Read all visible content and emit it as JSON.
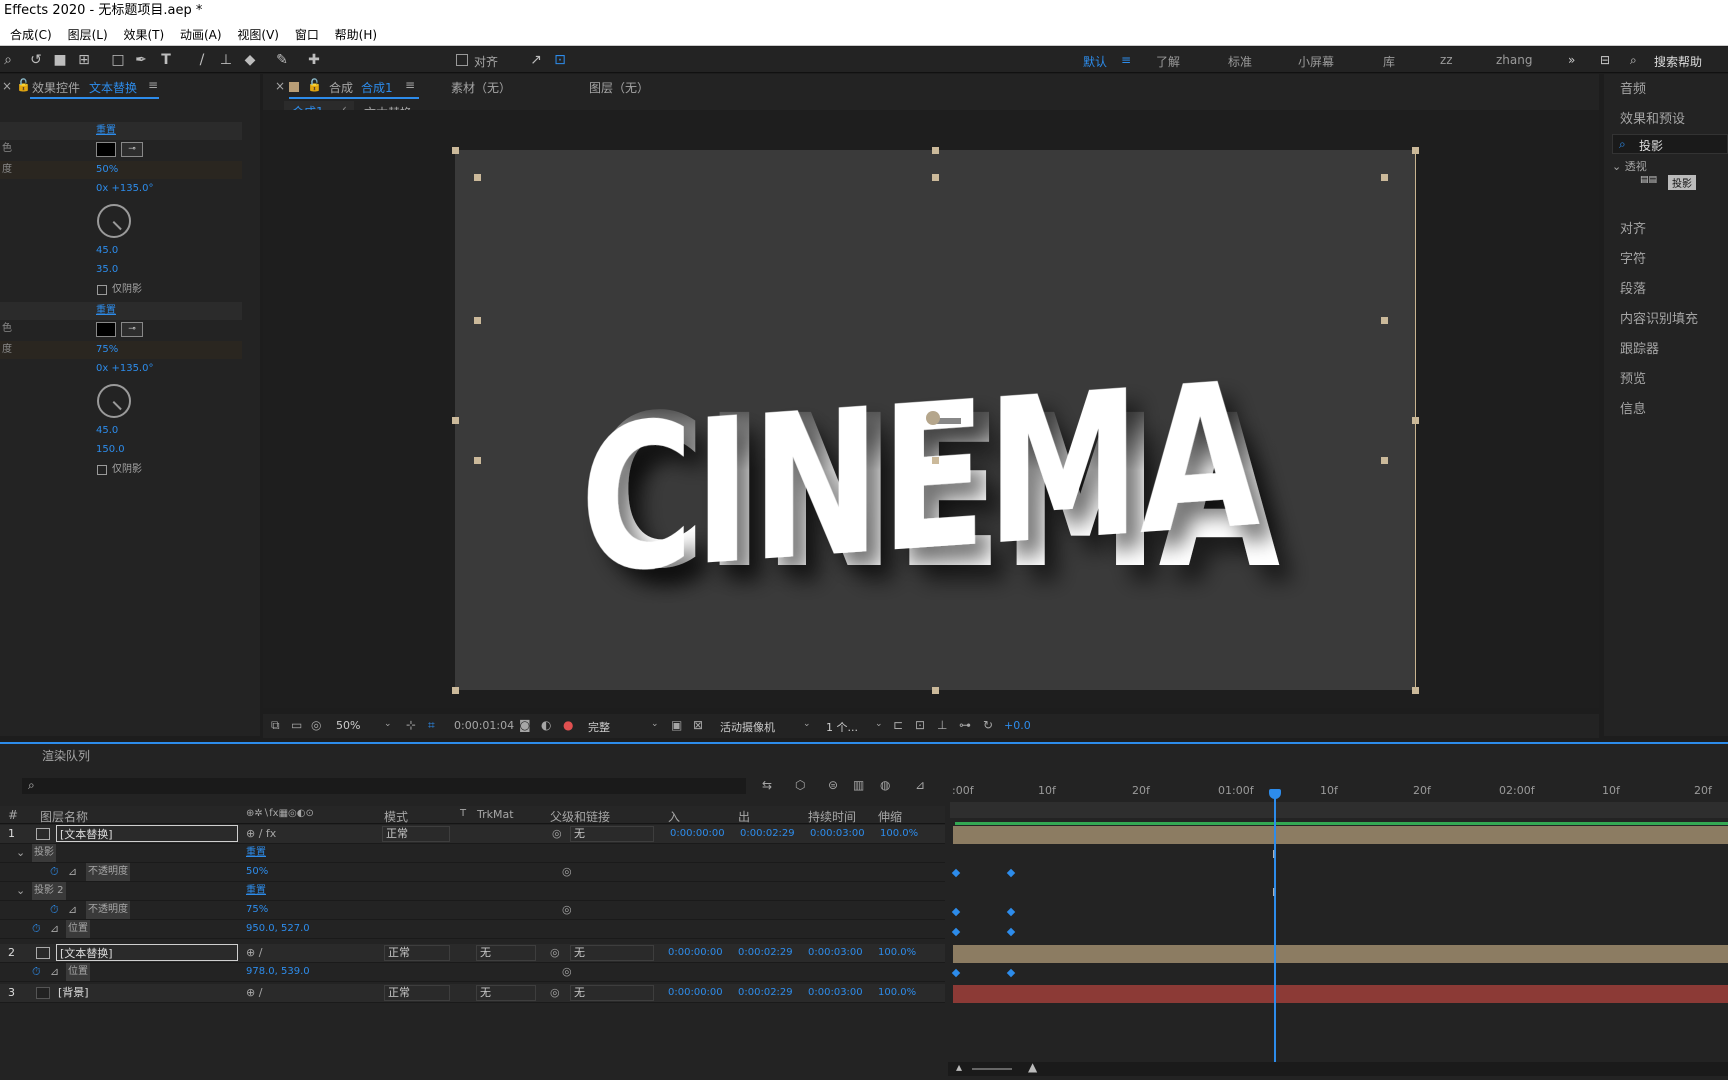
{
  "window_title": "Effects 2020 - 无标题项目.aep *",
  "menu": [
    "合成(C)",
    "图层(L)",
    "效果(T)",
    "动画(A)",
    "视图(V)",
    "窗口",
    "帮助(H)"
  ],
  "toolbar": {
    "align_label": "对齐",
    "workspaces": [
      "默认",
      "了解",
      "标准",
      "小屏幕",
      "库",
      "zz",
      "zhang"
    ],
    "active_workspace": "默认",
    "search_help": "搜索帮助"
  },
  "effect_controls": {
    "title": "效果控件",
    "layer_name": "文本替换",
    "rows": {
      "reset1": "重置",
      "opacity1_lab": "度",
      "opacity1": "50%",
      "dir1": "0x +135.0°",
      "dist1": "45.0",
      "soft1": "35.0",
      "shadow_only1": "仅阴影",
      "reset2": "重置",
      "opacity2_lab": "度",
      "opacity2": "75%",
      "dir2": "0x +135.0°",
      "dist2": "45.0",
      "soft2": "150.0",
      "shadow_only2": "仅阴影",
      "color_lab": "色"
    }
  },
  "comp_panel": {
    "tab_label": "合成",
    "tab_name": "合成1",
    "footage_tab": "素材（无）",
    "layer_tab": "图层（无）",
    "crumb1": "合成1",
    "crumb2": "文本替换",
    "text": "CINEMA"
  },
  "viewer_bar": {
    "zoom": "50%",
    "timecode": "0:00:01:04",
    "resolution": "完整",
    "camera": "活动摄像机",
    "views": "1 个...",
    "exposure": "+0.0"
  },
  "right_panel": {
    "audio": "音频",
    "effects_presets": "效果和预设",
    "search_value": "投影",
    "category": "透视",
    "result": "投影",
    "items": [
      "对齐",
      "字符",
      "段落",
      "内容识别填充",
      "跟踪器",
      "预览",
      "信息"
    ]
  },
  "timeline": {
    "render_queue": "渲染队列",
    "columns": {
      "num": "#",
      "name": "图层名称",
      "mode": "模式",
      "t": "T",
      "trkmat": "TrkMat",
      "parent": "父级和链接",
      "in": "入",
      "out": "出",
      "duration": "持续时间",
      "stretch": "伸缩"
    },
    "ruler": [
      ":00f",
      "10f",
      "20f",
      "01:00f",
      "10f",
      "20f",
      "02:00f",
      "10f",
      "20f"
    ],
    "layers": [
      {
        "num": "1",
        "name": "[文本替换]",
        "mode": "正常",
        "parent": "无",
        "in": "0:00:00:00",
        "out": "0:00:02:29",
        "dur": "0:00:03:00",
        "stretch": "100.0%"
      },
      {
        "num": "2",
        "name": "[文本替换]",
        "mode": "正常",
        "trk": "无",
        "parent": "无",
        "in": "0:00:00:00",
        "out": "0:00:02:29",
        "dur": "0:00:03:00",
        "stretch": "100.0%"
      },
      {
        "num": "3",
        "name": "[背景]",
        "mode": "正常",
        "trk": "无",
        "parent": "无",
        "in": "0:00:00:00",
        "out": "0:00:02:29",
        "dur": "0:00:03:00",
        "stretch": "100.0%"
      }
    ],
    "sub": {
      "shadow1": "投影",
      "reset1": "重置",
      "opacity_lab": "不透明度",
      "opacity1": "50%",
      "shadow2": "投影 2",
      "reset2": "重置",
      "opacity2": "75%",
      "position_lab": "位置",
      "pos1": "950.0, 527.0",
      "pos2": "978.0, 539.0"
    }
  }
}
